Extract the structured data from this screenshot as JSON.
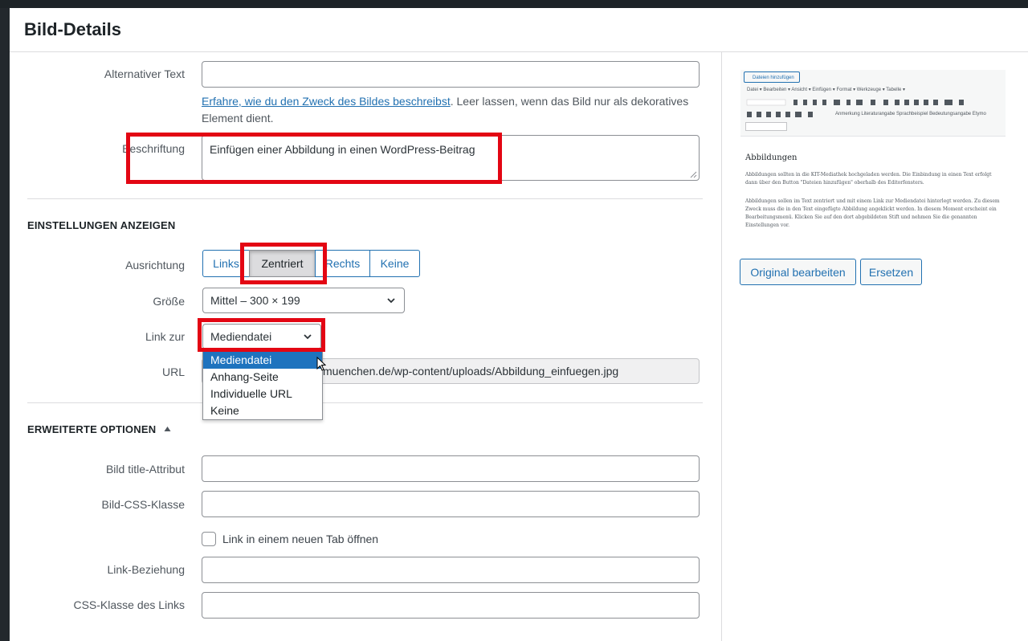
{
  "modal": {
    "title": "Bild-Details"
  },
  "fields": {
    "alt_text": {
      "label": "Alternativer Text",
      "value": ""
    },
    "alt_help_link": "Erfahre, wie du den Zweck des Bildes beschreibst",
    "alt_help_text": ". Leer lassen, wenn das Bild nur als dekoratives Element dient.",
    "caption": {
      "label": "Beschriftung",
      "value": "Einfügen einer Abbildung in einen WordPress-Beitrag"
    }
  },
  "display_settings": {
    "heading": "EINSTELLUNGEN ANZEIGEN",
    "alignment": {
      "label": "Ausrichtung",
      "options": [
        "Links",
        "Zentriert",
        "Rechts",
        "Keine"
      ],
      "selected": "Zentriert"
    },
    "size": {
      "label": "Größe",
      "value": "Mittel – 300 × 199"
    },
    "link_to": {
      "label": "Link zur",
      "value": "Mediendatei",
      "options": [
        "Mediendatei",
        "Anhang-Seite",
        "Individuelle URL",
        "Keine"
      ]
    },
    "url": {
      "label": "URL",
      "value": "muenchen.de/wp-content/uploads/Abbildung_einfuegen.jpg"
    }
  },
  "advanced": {
    "heading": "ERWEITERTE OPTIONEN",
    "title_attr": {
      "label": "Bild title-Attribut",
      "value": ""
    },
    "css_class": {
      "label": "Bild-CSS-Klasse",
      "value": ""
    },
    "new_tab": {
      "label": "Link in einem neuen Tab öffnen",
      "checked": false
    },
    "link_rel": {
      "label": "Link-Beziehung",
      "value": ""
    },
    "link_css": {
      "label": "CSS-Klasse des Links",
      "value": ""
    }
  },
  "sidebar": {
    "buttons": {
      "edit": "Original bearbeiten",
      "replace": "Ersetzen"
    },
    "preview": {
      "add_media": "Dateien hinzufügen",
      "menu": "Datei ▾   Bearbeiten ▾   Ansicht ▾   Einfügen ▾   Format ▾   Werkzeuge ▾   Tabelle ▾",
      "tools_text": "Anmerkung   Literaturangabe   Sprachbeispiel   Bedeutungsangabe   Etymo",
      "heading": "Abbildungen",
      "para1": "Abbildungen sollten in die KIT-Mediathek hochgeladen werden. Die Einbindung in einen Text erfolgt dann über den Button \"Dateien hinzufügen\" oberhalb des Editorfensters.",
      "para2": "Abbildungen sollen im Text zentriert und mit einem Link zur Mediendatei hinterlegt werden. Zu diesem Zweck muss die in den Text eingefügte Abbildung angeklickt werden. In diesem Moment erscheint ein Bearbeitungsmenü. Klicken Sie auf den dort abgebildeten Stift und nehmen Sie die genannten Einstellungen vor."
    }
  },
  "colors": {
    "accent": "#2271b1",
    "highlight": "#e30613",
    "selected": "#1e73be"
  }
}
